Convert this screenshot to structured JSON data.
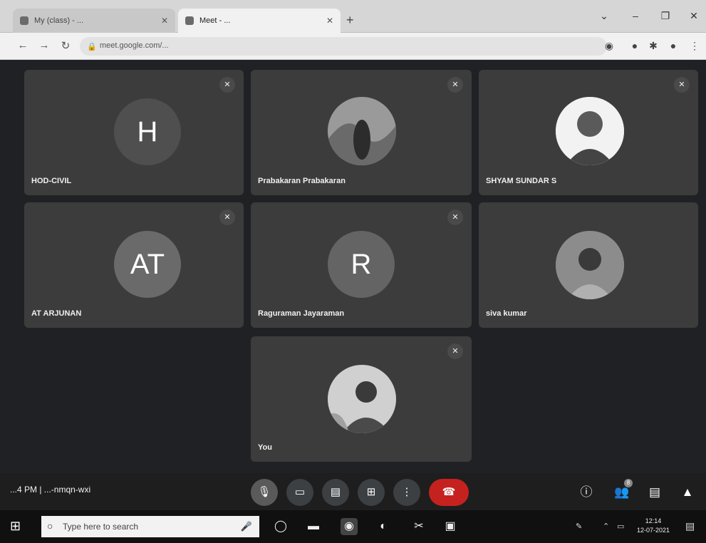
{
  "browser": {
    "tabs": [
      {
        "label": "My (class) - ..."
      },
      {
        "label": "Meet - ..."
      }
    ],
    "new_tab": "+",
    "url": "meet.google.com/...",
    "window_controls": [
      "⌄",
      "–",
      "❐",
      "✕"
    ]
  },
  "participants": [
    {
      "name": "HOD-CIVIL",
      "initials": "H",
      "kind": "initials"
    },
    {
      "name": "Prabakaran Prabakaran",
      "initials": "",
      "kind": "photo"
    },
    {
      "name": "SHYAM SUNDAR S",
      "initials": "",
      "kind": "photo"
    },
    {
      "name": "AT ARJUNAN",
      "initials": "AT",
      "kind": "initials"
    },
    {
      "name": "Raguraman Jayaraman",
      "initials": "R",
      "kind": "initials"
    },
    {
      "name": "siva kumar",
      "initials": "",
      "kind": "photo"
    },
    {
      "name": "You",
      "initials": "",
      "kind": "photo"
    }
  ],
  "controls": {
    "meeting_info": "...4 PM  |  ...-nmqn-wxi",
    "people_badge": "8"
  },
  "taskbar": {
    "search_placeholder": "Type here to search",
    "time": "12:14",
    "date": "12-07-2021"
  },
  "icons": {
    "mic": "mic-off-icon",
    "camera": "camera-icon",
    "captions": "captions-icon",
    "present": "present-icon",
    "more": "more-icon",
    "end": "end-call-icon"
  }
}
